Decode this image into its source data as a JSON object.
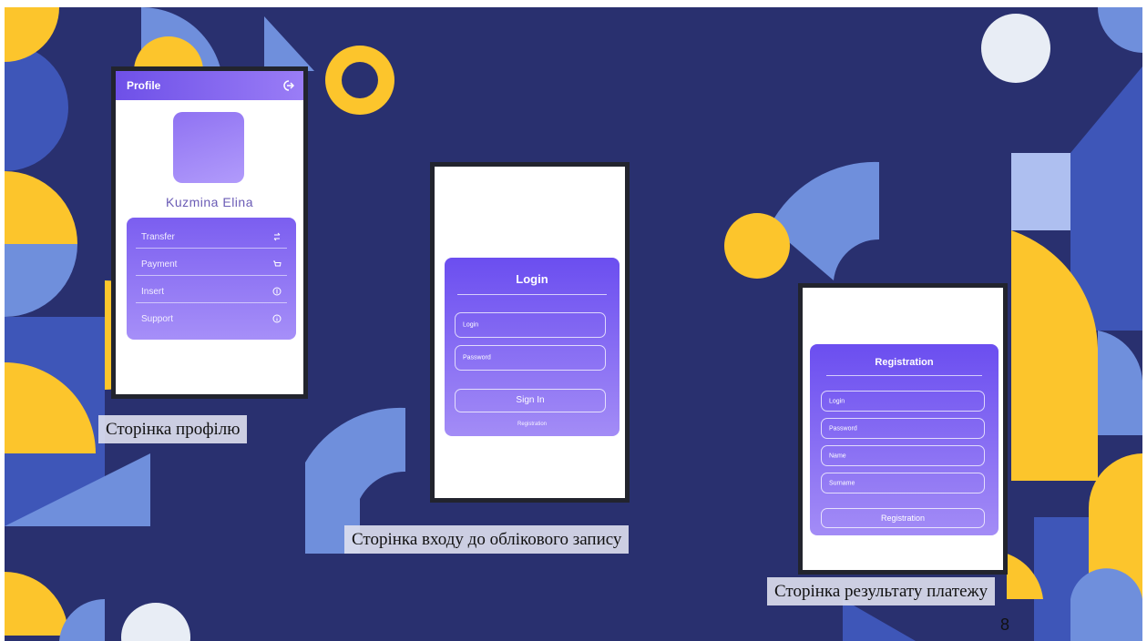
{
  "slide": {
    "page_number": "8",
    "colors": {
      "background": "#29306f",
      "yellow": "#fcc52c",
      "light_blue": "#6f8fdc",
      "pale": "#e8edf5",
      "accent_purple": "#7b5ef0"
    }
  },
  "profile_screen": {
    "header_title": "Profile",
    "logout_icon": "logout-icon",
    "user_name": "Kuzmina Elina",
    "menu_items": [
      {
        "label": "Transfer",
        "icon": "swap-arrows-icon"
      },
      {
        "label": "Payment",
        "icon": "cart-icon"
      },
      {
        "label": "Insert",
        "icon": "coin-icon"
      },
      {
        "label": "Support",
        "icon": "info-icon"
      }
    ],
    "caption": "Сторінка профілю"
  },
  "login_screen": {
    "title": "Login",
    "login_placeholder": "Login",
    "password_placeholder": "Password",
    "sign_in_label": "Sign In",
    "registration_link": "Registration",
    "caption": "Сторінка входу до облікового запису"
  },
  "registration_screen": {
    "title": "Registration",
    "fields": [
      "Login",
      "Password",
      "Name",
      "Surname"
    ],
    "button_label": "Registration",
    "caption": "Сторінка результату платежу"
  }
}
